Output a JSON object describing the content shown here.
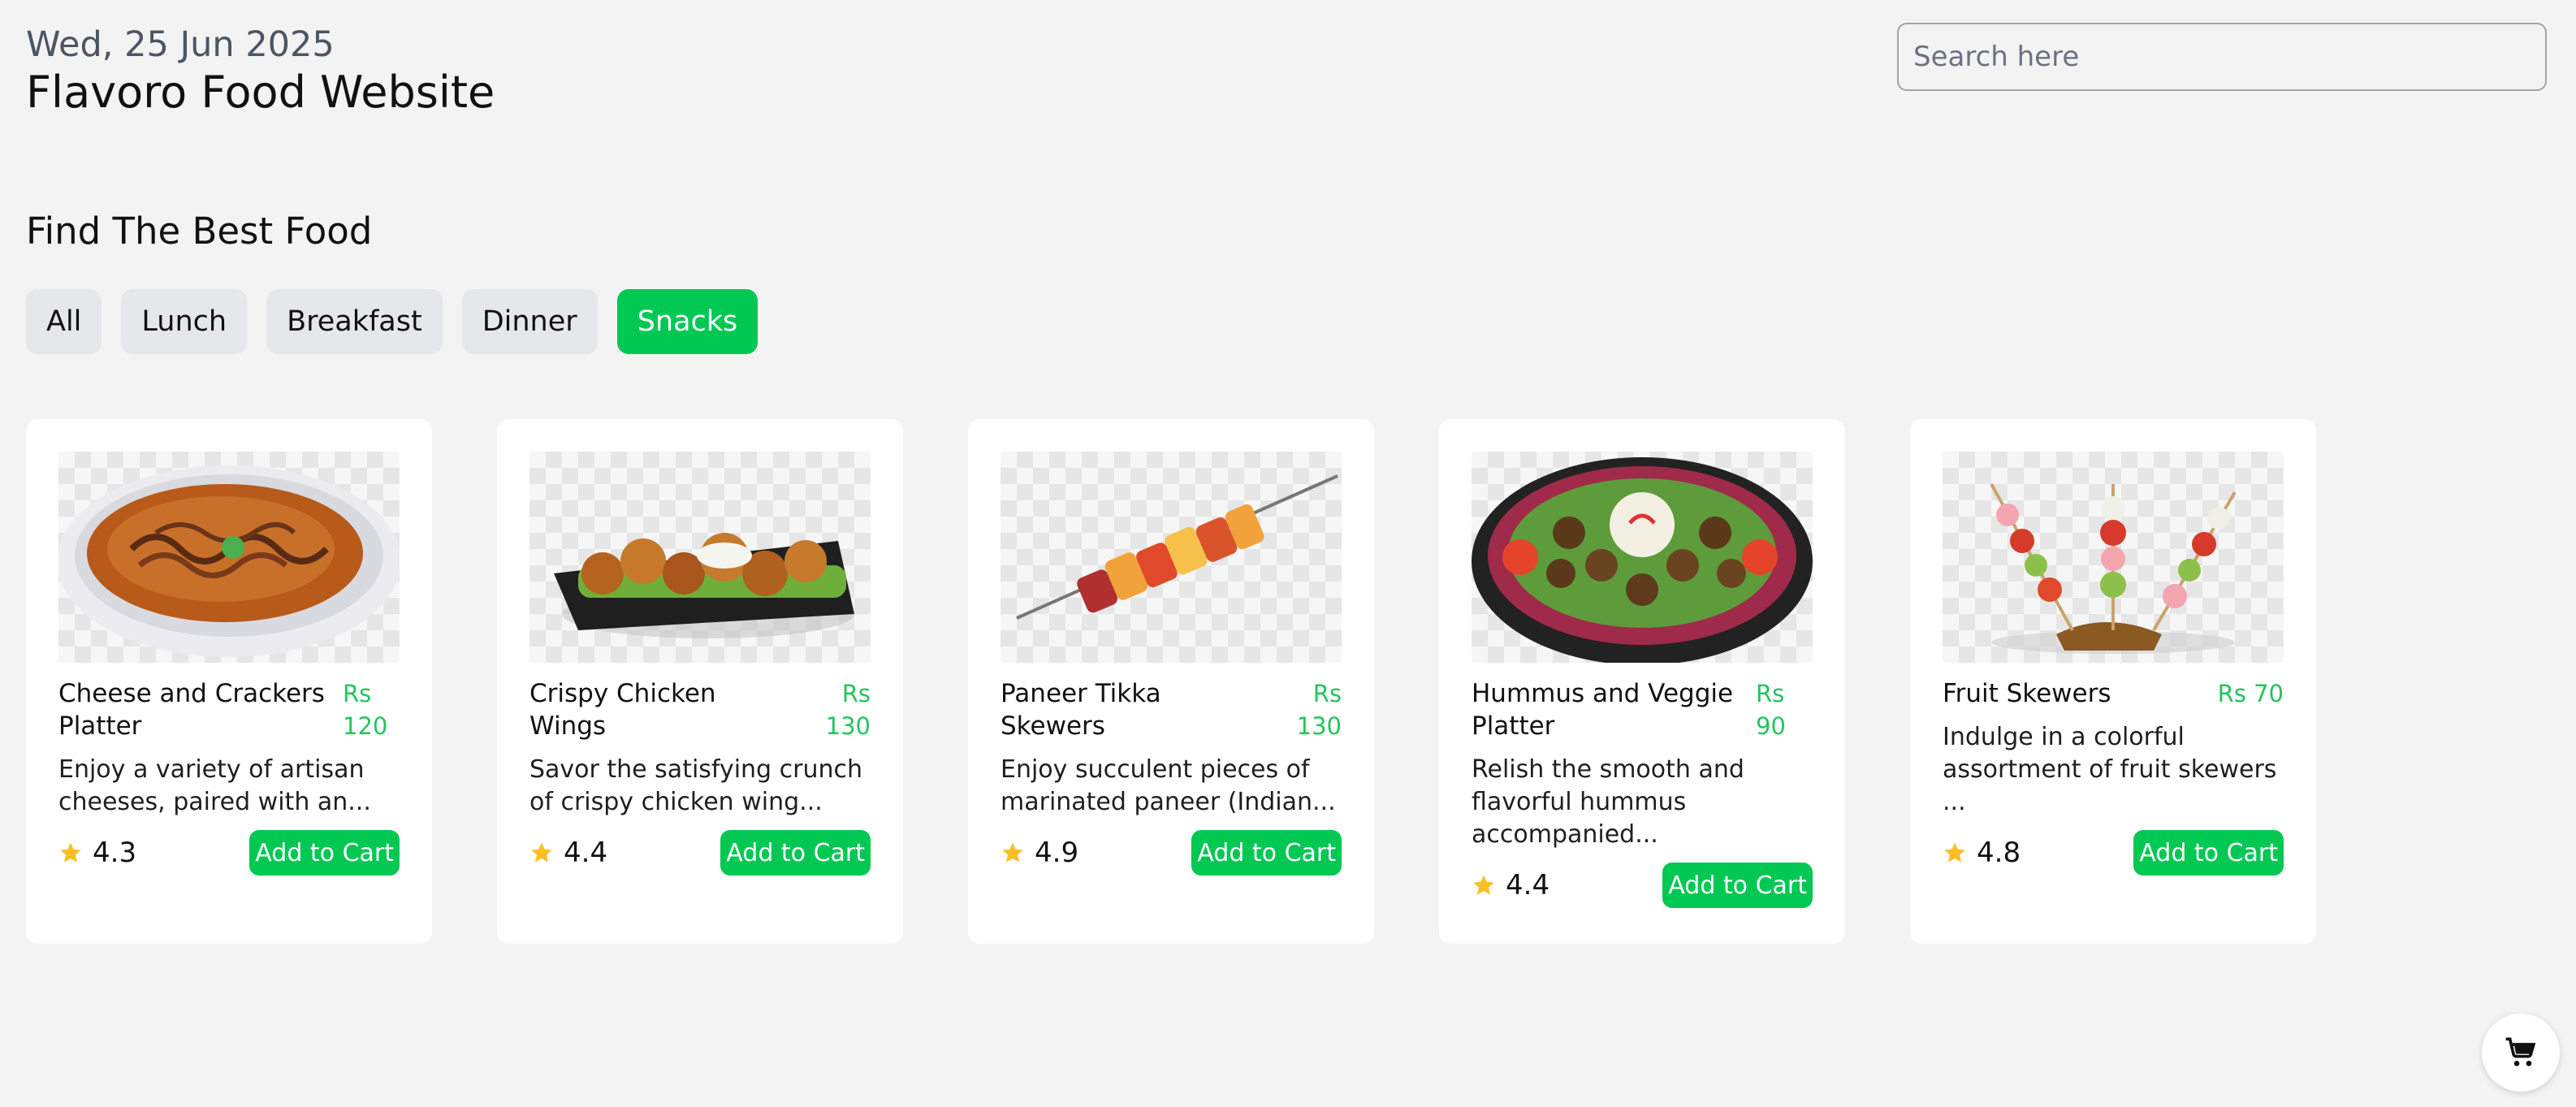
{
  "header": {
    "date": "Wed, 25 Jun 2025",
    "title": "Flavoro Food Website",
    "search_placeholder": "Search here"
  },
  "section_title": "Find The Best Food",
  "filters": [
    {
      "label": "All",
      "active": false
    },
    {
      "label": "Lunch",
      "active": false
    },
    {
      "label": "Breakfast",
      "active": false
    },
    {
      "label": "Dinner",
      "active": false
    },
    {
      "label": "Snacks",
      "active": true
    }
  ],
  "colors": {
    "accent": "#00c853",
    "price": "#22c55e",
    "star": "#fbbf24",
    "chip": "#e5e7eb"
  },
  "cards": [
    {
      "name": "Cheese and Crackers Platter",
      "price": "Rs 120",
      "desc": "Enjoy a variety of artisan cheeses, paired with an...",
      "rating": "4.3",
      "button": "Add to Cart"
    },
    {
      "name": "Crispy Chicken Wings",
      "price": "Rs 130",
      "desc": "Savor the satisfying crunch of crispy chicken wing...",
      "rating": "4.4",
      "button": "Add to Cart"
    },
    {
      "name": "Paneer Tikka Skewers",
      "price": "Rs 130",
      "desc": "Enjoy succulent pieces of marinated paneer (Indian...",
      "rating": "4.9",
      "button": "Add to Cart"
    },
    {
      "name": "Hummus and Veggie Platter",
      "price": "Rs 90",
      "desc": "Relish the smooth and flavorful hummus accompanied...",
      "rating": "4.4",
      "button": "Add to Cart"
    },
    {
      "name": "Fruit Skewers",
      "price": "Rs 70",
      "desc": "Indulge in a colorful assortment of fruit skewers ...",
      "rating": "4.8",
      "button": "Add to Cart"
    }
  ],
  "icons": {
    "star": "star-icon",
    "cart": "shopping-cart-icon"
  }
}
